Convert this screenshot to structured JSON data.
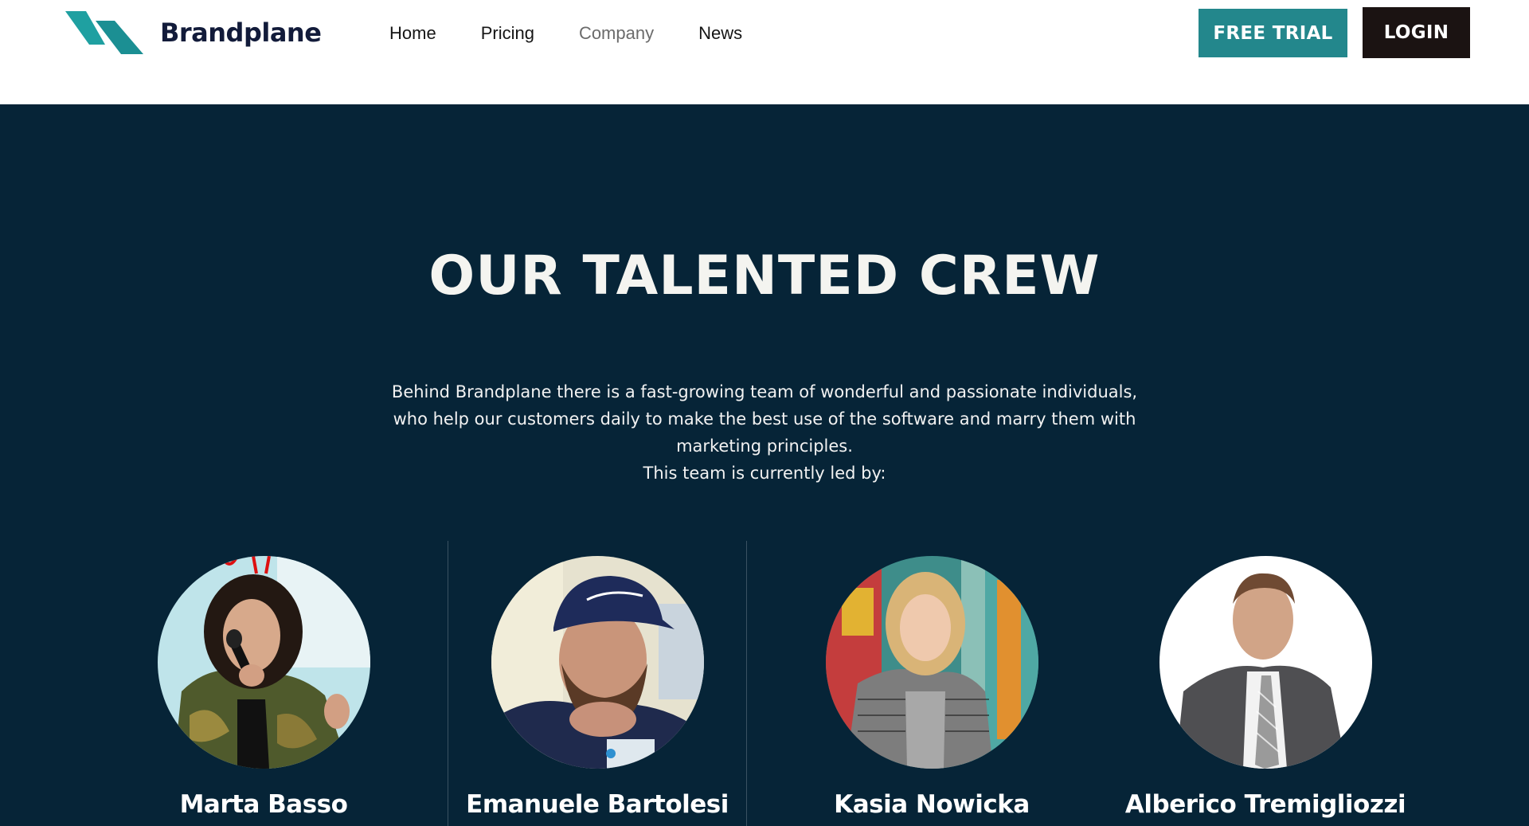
{
  "header": {
    "brand_name": "Brandplane",
    "nav": [
      "Home",
      "Pricing",
      "Company",
      "News"
    ],
    "free_trial_label": "FREE TRIAL",
    "login_label": "LOGIN"
  },
  "crew": {
    "title": "OUR TALENTED CREW",
    "intro_lines": [
      "Behind Brandplane there is a fast-growing team of wonderful and passionate individuals,",
      "who help our customers daily to make the best use of the software and marry them with",
      "marketing principles.",
      "This team is currently led by:"
    ],
    "members": [
      {
        "name": "Marta Basso"
      },
      {
        "name": "Emanuele Bartolesi"
      },
      {
        "name": "Kasia Nowicka"
      },
      {
        "name": "Alberico Tremigliozzi"
      }
    ]
  },
  "colors": {
    "brand_teal": "#23878c",
    "login_dark": "#1b1312",
    "section_bg": "#062437",
    "logo_text": "#121b3a"
  },
  "icons": [
    "brandplane-logo-icon"
  ]
}
